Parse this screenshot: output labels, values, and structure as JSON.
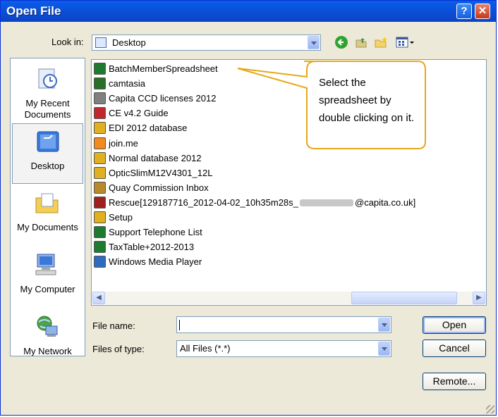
{
  "window": {
    "title": "Open File",
    "help_label": "?",
    "close_label": "✕"
  },
  "lookin": {
    "label": "Look in:",
    "value": "Desktop"
  },
  "toolbar": {
    "icons": [
      "back-icon",
      "up-folder-icon",
      "new-folder-icon",
      "views-menu-icon"
    ]
  },
  "places": [
    {
      "label": "My Recent Documents",
      "icon": "recent-documents-icon",
      "selected": false
    },
    {
      "label": "Desktop",
      "icon": "desktop-icon",
      "selected": true
    },
    {
      "label": "My Documents",
      "icon": "my-documents-icon",
      "selected": false
    },
    {
      "label": "My Computer",
      "icon": "my-computer-icon",
      "selected": false
    },
    {
      "label": "My Network",
      "icon": "my-network-icon",
      "selected": false
    }
  ],
  "files": [
    {
      "name": "BatchMemberSpreadsheet",
      "icon": "excel-file-icon",
      "color": "#1e7a2e"
    },
    {
      "name": "camtasia",
      "icon": "shortcut-icon",
      "color": "#2a6e2a"
    },
    {
      "name": "Capita CCD licenses 2012",
      "icon": "text-file-icon",
      "color": "#808080"
    },
    {
      "name": "CE v4.2 Guide",
      "icon": "pdf-file-icon",
      "color": "#c0282d"
    },
    {
      "name": "EDI 2012 database",
      "icon": "zip-folder-icon",
      "color": "#e0b020"
    },
    {
      "name": "join.me",
      "icon": "shortcut-icon",
      "color": "#f28a1e"
    },
    {
      "name": "Normal database 2012",
      "icon": "zip-folder-icon",
      "color": "#e0b020"
    },
    {
      "name": "OpticSlimM12V4301_12L",
      "icon": "zip-folder-icon",
      "color": "#e0b020"
    },
    {
      "name": "Quay Commission Inbox",
      "icon": "mail-icon",
      "color": "#b88a2a"
    },
    {
      "name": "Rescue[129187716_2012-04-02_10h35m28s_",
      "suffix": "@capita.co.uk]",
      "icon": "app-file-icon",
      "color": "#a02020"
    },
    {
      "name": "Setup",
      "icon": "zip-folder-icon",
      "color": "#e0b020"
    },
    {
      "name": "Support Telephone List",
      "icon": "excel-file-icon",
      "color": "#1e7a2e"
    },
    {
      "name": "TaxTable+2012-2013",
      "icon": "excel-file-icon",
      "color": "#1e7a2e"
    },
    {
      "name": "Windows Media Player",
      "icon": "media-player-icon",
      "color": "#2f6cc0"
    }
  ],
  "callout": {
    "text": "Select the spreadsheet by double clicking on it."
  },
  "filename": {
    "label": "File name:",
    "value": ""
  },
  "filetype": {
    "label": "Files of type:",
    "value": "All Files (*.*)"
  },
  "buttons": {
    "open": "Open",
    "cancel": "Cancel",
    "remote": "Remote..."
  },
  "colors": {
    "title_bar": "#0a5ee8",
    "dialog_bg": "#ece9d8",
    "callout_border": "#e6a817"
  }
}
